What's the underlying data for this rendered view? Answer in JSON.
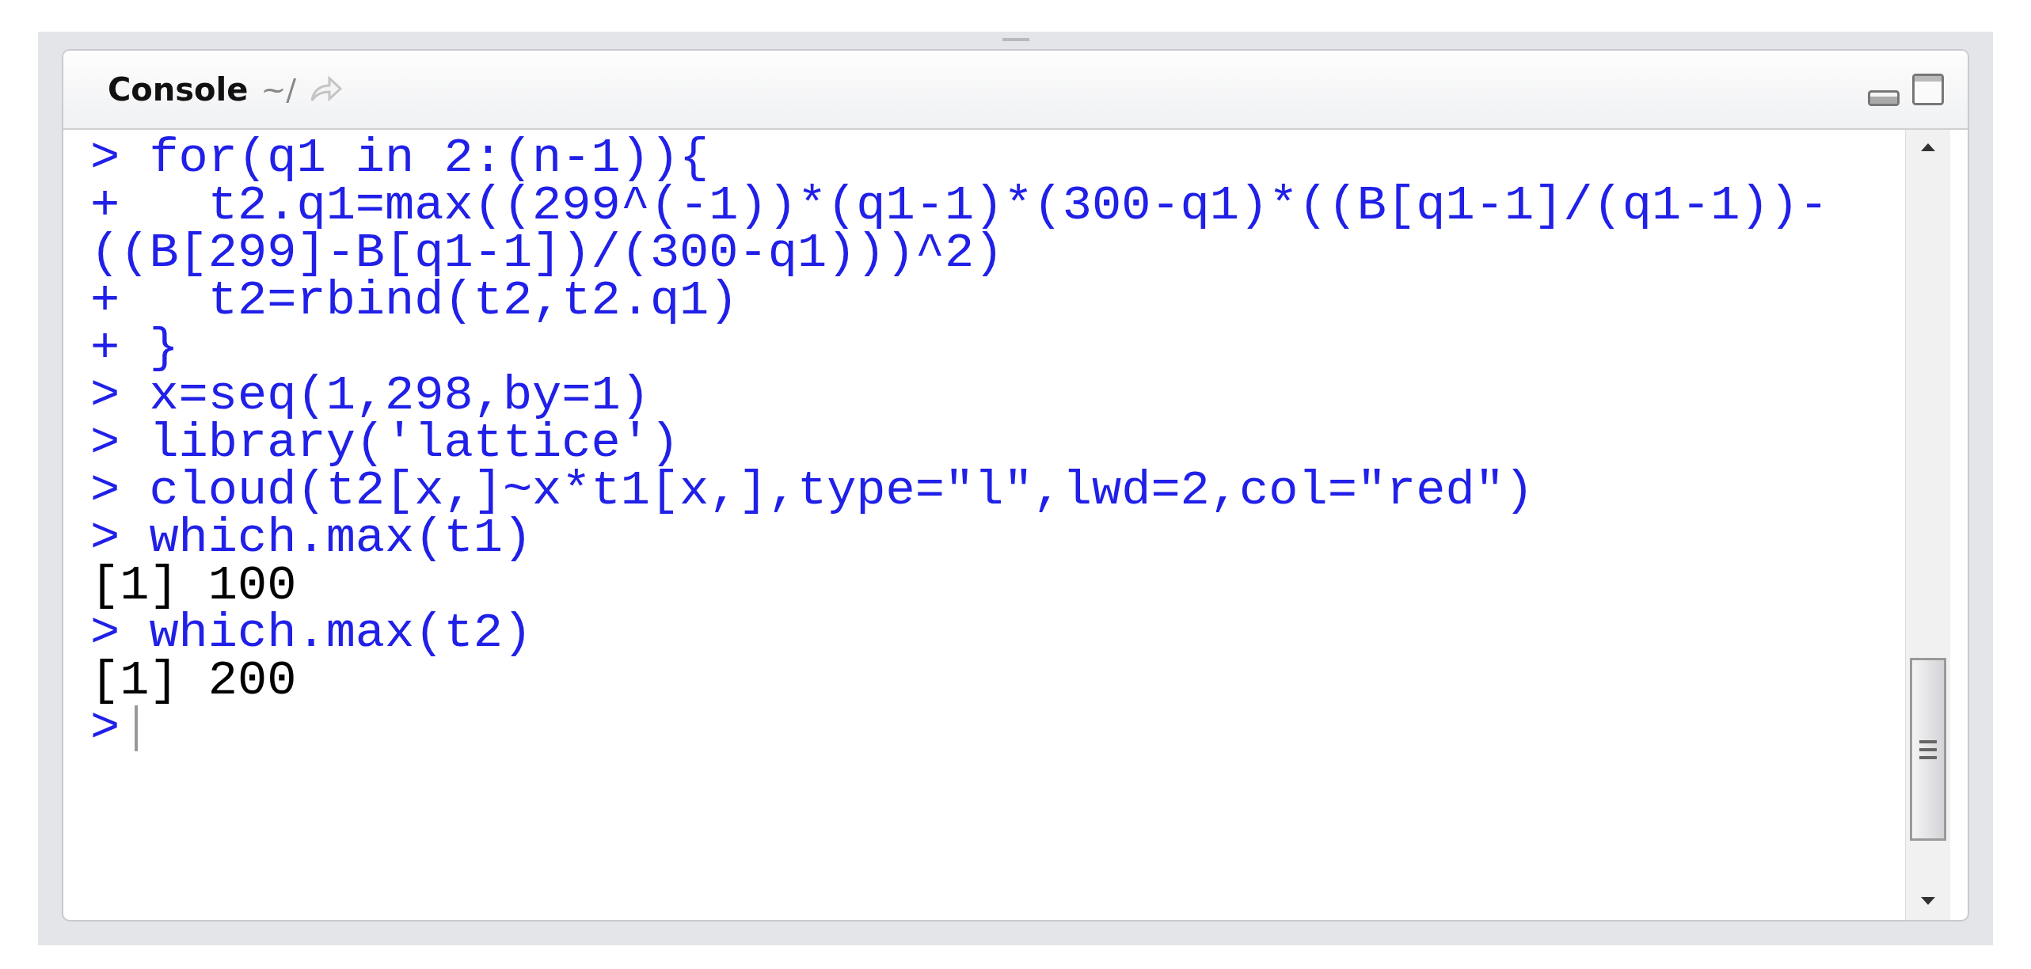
{
  "pane": {
    "title": "Console",
    "path": "~/"
  },
  "console_lines": [
    {
      "kind": "input",
      "prompt": ">",
      "text": "for(q1 in 2:(n-1)){"
    },
    {
      "kind": "input",
      "prompt": "+",
      "text": "  t2.q1=max((299^(-1))*(q1-1)*(300-q1)*((B[q1-1]/(q1-1))-((B[299]-B[q1-1])/(300-q1)))^2)"
    },
    {
      "kind": "input",
      "prompt": "+",
      "text": "  t2=rbind(t2,t2.q1)"
    },
    {
      "kind": "input",
      "prompt": "+",
      "text": "}"
    },
    {
      "kind": "input",
      "prompt": ">",
      "text": "x=seq(1,298,by=1)"
    },
    {
      "kind": "input",
      "prompt": ">",
      "text": "library('lattice')"
    },
    {
      "kind": "input",
      "prompt": ">",
      "text": "cloud(t2[x,]~x*t1[x,],type=\"l\",lwd=2,col=\"red\")"
    },
    {
      "kind": "input",
      "prompt": ">",
      "text": "which.max(t1)"
    },
    {
      "kind": "output",
      "text": "[1] 100"
    },
    {
      "kind": "input",
      "prompt": ">",
      "text": "which.max(t2)"
    },
    {
      "kind": "output",
      "text": "[1] 200"
    }
  ],
  "input_prompt": ">"
}
